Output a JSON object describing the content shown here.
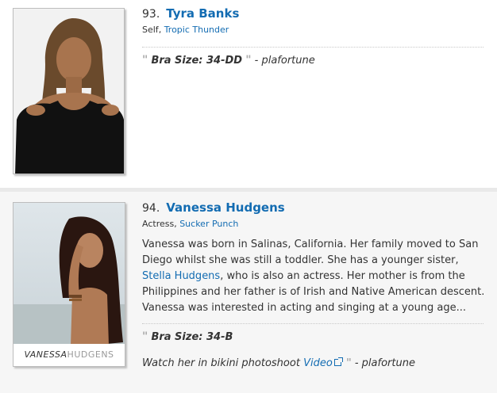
{
  "entries": [
    {
      "rank": "93.",
      "name": "Tyra Banks",
      "role": "Self",
      "film": "Tropic Thunder",
      "quote_text": "Bra Size: 34-DD",
      "quote_attribution": "- plafortune"
    },
    {
      "rank": "94.",
      "name": "Vanessa Hudgens",
      "role": "Actress",
      "film": "Sucker Punch",
      "bio_part1": "Vanessa was born in Salinas, California. Her family moved to San Diego whilst she was still a toddler. She has a younger sister,",
      "bio_link": "Stella Hudgens",
      "bio_part2": ", who is also an actress. Her mother is from the Philippines and her father is of Irish and Native American descent. Vanessa was interested in acting and singing at a young age...",
      "quote_text": "Bra Size: 34-B",
      "watch_text": "Watch her in bikini photoshoot",
      "watch_link": "Video",
      "watch_attribution": "- plafortune",
      "photo_caption_main": "VANESSA",
      "photo_caption_sub": "HUDGENS"
    }
  ],
  "colors": {
    "link": "#136cb2",
    "alt_background": "#f6f6f6"
  }
}
